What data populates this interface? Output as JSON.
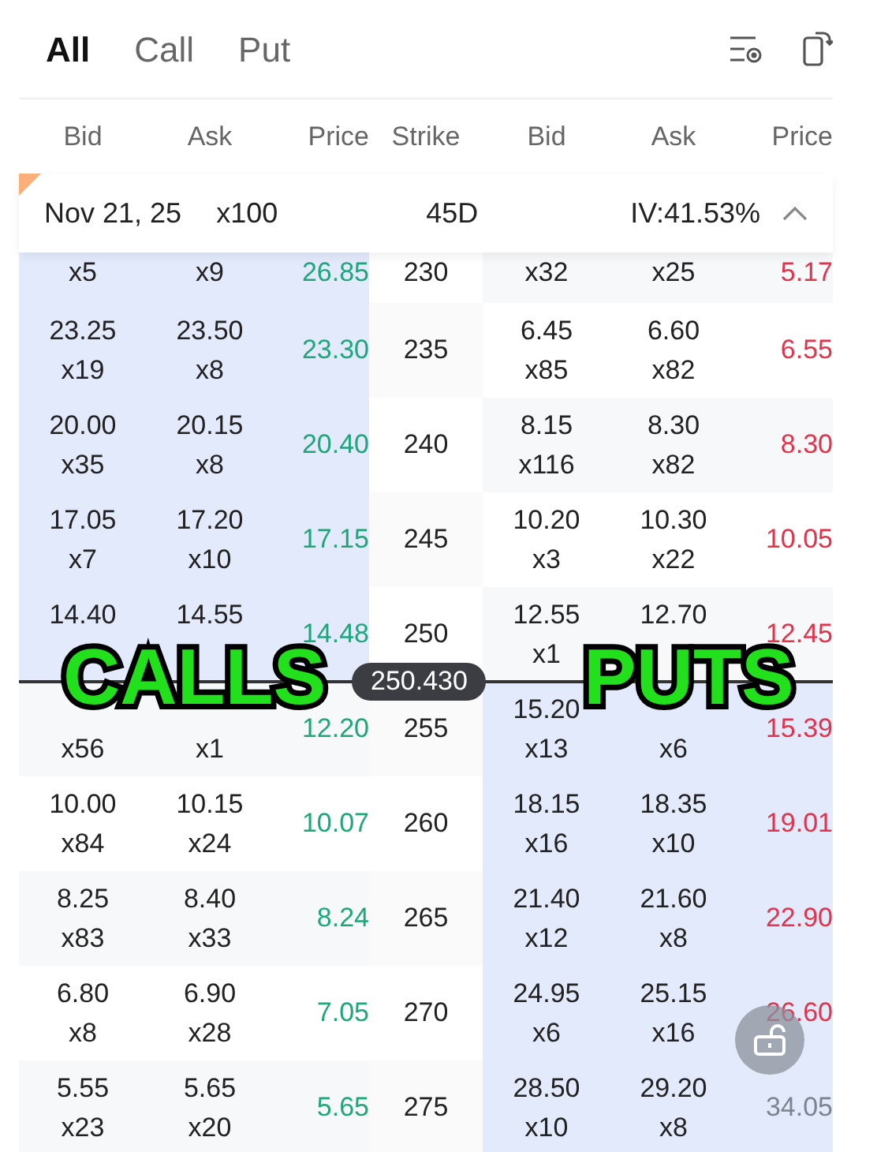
{
  "tabs": [
    {
      "label": "All",
      "selected": true
    },
    {
      "label": "Call",
      "selected": false
    },
    {
      "label": "Put",
      "selected": false
    }
  ],
  "columns": {
    "calls": [
      "Bid",
      "Ask",
      "Price"
    ],
    "strike": "Strike",
    "puts": [
      "Bid",
      "Ask",
      "Price"
    ]
  },
  "expiry": {
    "date": "Nov 21, 25",
    "multiplier": "x100",
    "days": "45D",
    "iv": "IV:41.53%",
    "expanded": true
  },
  "rows": [
    {
      "strike": "230",
      "spot_below": false,
      "calls": {
        "itm": true,
        "bid_size": "x5",
        "ask_size": "x9",
        "price": "26.85",
        "color": "#1fa67a"
      },
      "puts": {
        "itm": false,
        "bid_size": "x32",
        "ask_size": "x25",
        "price": "5.17",
        "color": "#e0344c"
      }
    },
    {
      "strike": "235",
      "spot_below": false,
      "calls": {
        "itm": true,
        "bid": "23.25",
        "bid_size": "x19",
        "ask": "23.50",
        "ask_size": "x8",
        "price": "23.30",
        "color": "#1fa67a"
      },
      "puts": {
        "itm": false,
        "bid": "6.45",
        "bid_size": "x85",
        "ask": "6.60",
        "ask_size": "x82",
        "price": "6.55",
        "color": "#e0344c"
      }
    },
    {
      "strike": "240",
      "spot_below": false,
      "calls": {
        "itm": true,
        "bid": "20.00",
        "bid_size": "x35",
        "ask": "20.15",
        "ask_size": "x8",
        "price": "20.40",
        "color": "#1fa67a"
      },
      "puts": {
        "itm": false,
        "bid": "8.15",
        "bid_size": "x116",
        "ask": "8.30",
        "ask_size": "x82",
        "price": "8.30",
        "color": "#e0344c"
      }
    },
    {
      "strike": "245",
      "spot_below": false,
      "calls": {
        "itm": true,
        "bid": "17.05",
        "bid_size": "x7",
        "ask": "17.20",
        "ask_size": "x10",
        "price": "17.15",
        "color": "#1fa67a"
      },
      "puts": {
        "itm": false,
        "bid": "10.20",
        "bid_size": "x3",
        "ask": "10.30",
        "ask_size": "x22",
        "price": "10.05",
        "color": "#e0344c"
      }
    },
    {
      "strike": "250",
      "spot_below": true,
      "calls": {
        "itm": true,
        "bid": "14.40",
        "ask": "14.55",
        "price": "14.48",
        "color": "#1fa67a"
      },
      "puts": {
        "itm": false,
        "bid": "12.55",
        "bid_size": "x1",
        "ask": "12.70",
        "price": "12.45",
        "color": "#e0344c"
      }
    },
    {
      "strike": "255",
      "spot_below": false,
      "calls": {
        "itm": false,
        "bid_size": "x56",
        "ask_size": "x1",
        "price": "12.20",
        "color": "#1fa67a"
      },
      "puts": {
        "itm": true,
        "bid": "15.20",
        "bid_size": "x13",
        "ask_size": "x6",
        "price": "15.39",
        "color": "#e0344c"
      }
    },
    {
      "strike": "260",
      "spot_below": false,
      "calls": {
        "itm": false,
        "bid": "10.00",
        "bid_size": "x84",
        "ask": "10.15",
        "ask_size": "x24",
        "price": "10.07",
        "color": "#1fa67a"
      },
      "puts": {
        "itm": true,
        "bid": "18.15",
        "bid_size": "x16",
        "ask": "18.35",
        "ask_size": "x10",
        "price": "19.01",
        "color": "#e0344c"
      }
    },
    {
      "strike": "265",
      "spot_below": false,
      "calls": {
        "itm": false,
        "bid": "8.25",
        "bid_size": "x83",
        "ask": "8.40",
        "ask_size": "x33",
        "price": "8.24",
        "color": "#1fa67a"
      },
      "puts": {
        "itm": true,
        "bid": "21.40",
        "bid_size": "x12",
        "ask": "21.60",
        "ask_size": "x8",
        "price": "22.90",
        "color": "#e0344c"
      }
    },
    {
      "strike": "270",
      "spot_below": false,
      "calls": {
        "itm": false,
        "bid": "6.80",
        "bid_size": "x8",
        "ask": "6.90",
        "ask_size": "x28",
        "price": "7.05",
        "color": "#1fa67a"
      },
      "puts": {
        "itm": true,
        "bid": "24.95",
        "bid_size": "x6",
        "ask": "25.15",
        "ask_size": "x16",
        "price": "26.60",
        "color": "#e0344c"
      }
    },
    {
      "strike": "275",
      "spot_below": false,
      "calls": {
        "itm": false,
        "bid": "5.55",
        "bid_size": "x23",
        "ask": "5.65",
        "ask_size": "x20",
        "price": "5.65",
        "color": "#1fa67a"
      },
      "puts": {
        "itm": true,
        "bid": "28.50",
        "bid_size": "x10",
        "ask": "29.20",
        "ask_size": "x8",
        "price": "34.05",
        "color": "#7d8593"
      }
    }
  ],
  "underlying_price": "250.430",
  "annotations": [
    {
      "text": "CALLS"
    },
    {
      "text": "PUTS"
    }
  ]
}
